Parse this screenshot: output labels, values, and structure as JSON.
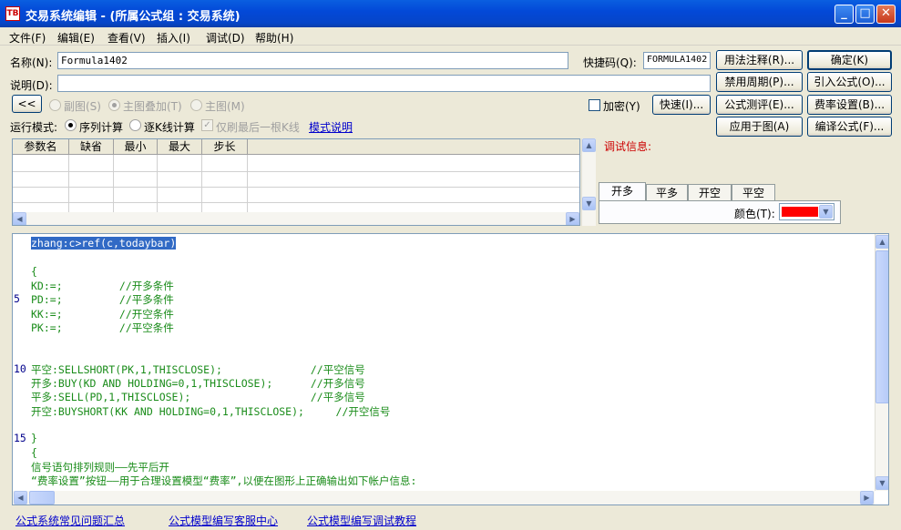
{
  "window": {
    "title": "交易系统编辑 - (所属公式组 : 交易系统)",
    "app_icon_text": "TB"
  },
  "menu": [
    "文件(F)",
    "编辑(E)",
    "查看(V)",
    "插入(I)",
    "调试(D)",
    "帮助(H)"
  ],
  "form": {
    "name_label": "名称(N):",
    "name_value": "Formula1402",
    "shortcut_label": "快捷码(Q):",
    "shortcut_value": "FORMULA1402",
    "desc_label": "说明(D):",
    "desc_value": ""
  },
  "buttons": {
    "usage": "用法注释(R)...",
    "ok": "确定(K)",
    "ban_period": "禁用周期(P)...",
    "import": "引入公式(O)...",
    "test": "公式测评(E)...",
    "fee": "费率设置(B)...",
    "apply": "应用于图(A)",
    "compile": "编译公式(F)...",
    "quick": "快速(I)...",
    "collapse": "<<"
  },
  "chart_mode": {
    "sub": "副图(S)",
    "main_overlay": "主图叠加(T)",
    "main": "主图(M)",
    "selected": "main_overlay"
  },
  "encrypt": {
    "label": "加密(Y)",
    "checked": false
  },
  "run_mode": {
    "label": "运行模式:",
    "sequential": "序列计算",
    "per_bar": "逐K线计算",
    "refresh_last": "仅刷最后一根K线",
    "mode_link": "模式说明",
    "selected": "sequential"
  },
  "params": {
    "headers": [
      "参数名",
      "缺省",
      "最小",
      "最大",
      "步长"
    ],
    "rows": []
  },
  "debug": {
    "label": "调试信息:",
    "tabs": [
      "开多",
      "平多",
      "开空",
      "平空"
    ],
    "active_tab": "开多",
    "color_label": "颜色(T):",
    "color_value": "#ff0000"
  },
  "editor": {
    "lines": [
      {
        "n": "",
        "text": "zhang:c>ref(c,todaybar)",
        "selected": true
      },
      {
        "n": "",
        "text": ""
      },
      {
        "n": "",
        "text": "{"
      },
      {
        "n": "",
        "text": "KD:=;         //开多条件"
      },
      {
        "n": "5",
        "text": "PD:=;         //平多条件"
      },
      {
        "n": "",
        "text": "KK:=;         //开空条件"
      },
      {
        "n": "",
        "text": "PK:=;         //平空条件"
      },
      {
        "n": "",
        "text": ""
      },
      {
        "n": "",
        "text": ""
      },
      {
        "n": "10",
        "text": "平空:SELLSHORT(PK,1,THISCLOSE);              //平空信号"
      },
      {
        "n": "",
        "text": "开多:BUY(KD AND HOLDING=0,1,THISCLOSE);      //开多信号"
      },
      {
        "n": "",
        "text": "平多:SELL(PD,1,THISCLOSE);                   //平多信号"
      },
      {
        "n": "",
        "text": "开空:BUYSHORT(KK AND HOLDING=0,1,THISCLOSE);     //开空信号"
      },
      {
        "n": "",
        "text": ""
      },
      {
        "n": "15",
        "text": "}"
      },
      {
        "n": "",
        "text": "{"
      },
      {
        "n": "",
        "text": "信号语句排列规则——先平后开"
      },
      {
        "n": "",
        "text": "“费率设置”按钮——用于合理设置模型“费率”,以便在图形上正确输出如下帐户信息:"
      }
    ]
  },
  "footer_links": [
    "公式系统常见问题汇总",
    "公式模型编写客服中心",
    "公式模型编写调试教程"
  ]
}
